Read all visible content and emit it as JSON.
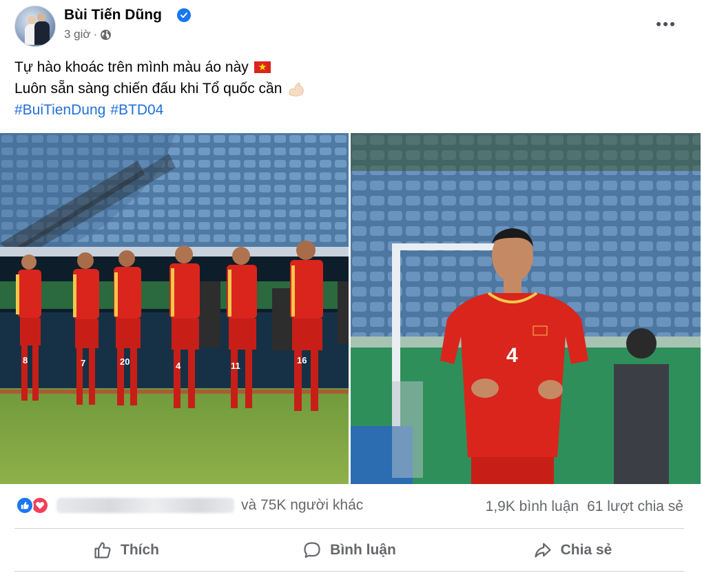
{
  "post": {
    "author": "Bùi Tiến Dũng",
    "time": "3 giờ",
    "separator": "·",
    "caption_line1": "Tự hào khoác trên mình màu áo này",
    "caption_line2": "Luôn sẵn sàng chiến đấu khi Tổ quốc cần",
    "hashtags": [
      "#BuiTienDung",
      "#BTD04"
    ],
    "icons": {
      "verified": "verified-badge-icon",
      "privacy": "globe-icon",
      "more": "more-options-icon",
      "flag": "vietnam-flag-emoji",
      "muscle": "flexed-biceps-emoji"
    }
  },
  "photos": {
    "left": {
      "jersey_numbers": [
        "8",
        "7",
        "20",
        "4",
        "11",
        "16"
      ]
    },
    "right": {
      "jersey_number": "4"
    }
  },
  "reactions": {
    "types": [
      "like",
      "love"
    ],
    "others_text": "và 75K người khác",
    "comments": "1,9K bình luận",
    "shares": "61 lượt chia sẻ"
  },
  "actions": {
    "like": "Thích",
    "comment": "Bình luận",
    "share": "Chia sẻ"
  },
  "colors": {
    "link": "#216fdb",
    "like_blue": "#1877f2",
    "love_red": "#f33e58",
    "secondary_text": "#65676b",
    "jersey_red": "#d9251c"
  }
}
